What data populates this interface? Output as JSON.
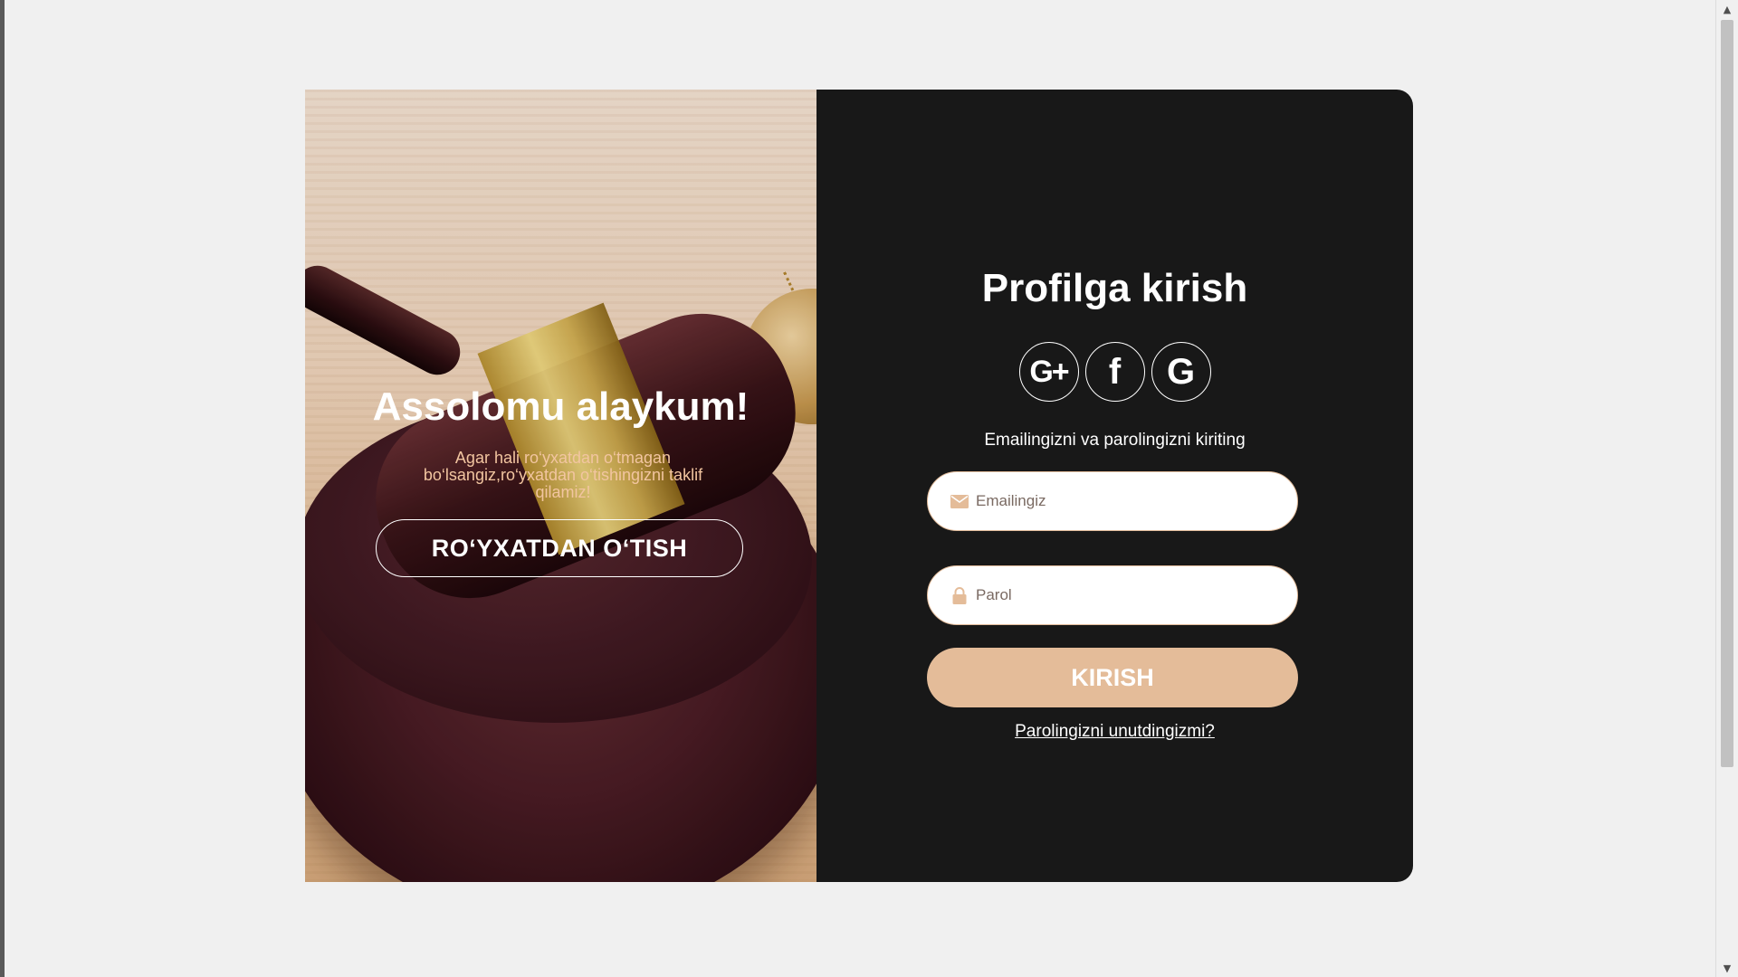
{
  "left": {
    "title": "Assolomu alaykum!",
    "text": "Agar hali ro‘yxatdan o‘tmagan bo‘lsangiz,ro‘yxatdan o‘tishingizni taklif qilamiz!",
    "signup_label": "RO‘YXATDAN O‘TISH"
  },
  "right": {
    "title": "Profilga kirish",
    "social": [
      {
        "icon": "google-plus-icon",
        "glyph": "G+"
      },
      {
        "icon": "facebook-icon",
        "glyph": "f"
      },
      {
        "icon": "google-icon",
        "glyph": "G"
      }
    ],
    "subtitle": "Emailingizni va parolingizni kiriting",
    "email_placeholder": "Emailingiz",
    "password_placeholder": "Parol",
    "submit_label": "KIRISH",
    "forgot_label": "Parolingizni unutdingizmi?"
  },
  "colors": {
    "accent": "#e4bc99",
    "panel_dark": "#181818",
    "page_bg": "#f0f0f0",
    "welcome_text": "#f2c5a0"
  }
}
